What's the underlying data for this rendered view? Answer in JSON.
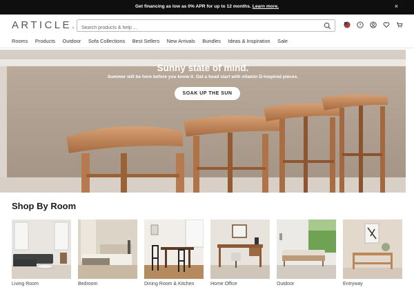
{
  "promo": {
    "text": "Get financing as low as 0% APR for up to 12 months.",
    "link": "Learn more.",
    "close": "×"
  },
  "header": {
    "logo": "ARTICLE",
    "logo_dot": ".",
    "search_placeholder": "Search products & help ...",
    "icons": [
      "flag-icon",
      "help-icon",
      "account-icon",
      "heart-icon",
      "cart-icon"
    ]
  },
  "nav": {
    "items": [
      "Rooms",
      "Products",
      "Outdoor",
      "Sofa Collections",
      "Best Sellers",
      "New Arrivals",
      "Bundles",
      "Ideas & Inspiration",
      "Sale"
    ]
  },
  "hero": {
    "title": "Sunny state of mind.",
    "subtitle": "Summer will be here before you know it. Get a head start with vitamin D-inspired pieces.",
    "cta": "SOAK UP THE SUN"
  },
  "shop_by_room": {
    "title": "Shop By Room",
    "rooms": [
      {
        "label": "Living Room"
      },
      {
        "label": "Bedroom"
      },
      {
        "label": "Dining Room & Kitchen"
      },
      {
        "label": "Home Office"
      },
      {
        "label": "Outdoor"
      },
      {
        "label": "Entryway"
      }
    ]
  },
  "colors": {
    "promo_bg": "#0f0f0f",
    "logo_accent": "#e2563b",
    "stool_wood": "#b77a4e"
  }
}
